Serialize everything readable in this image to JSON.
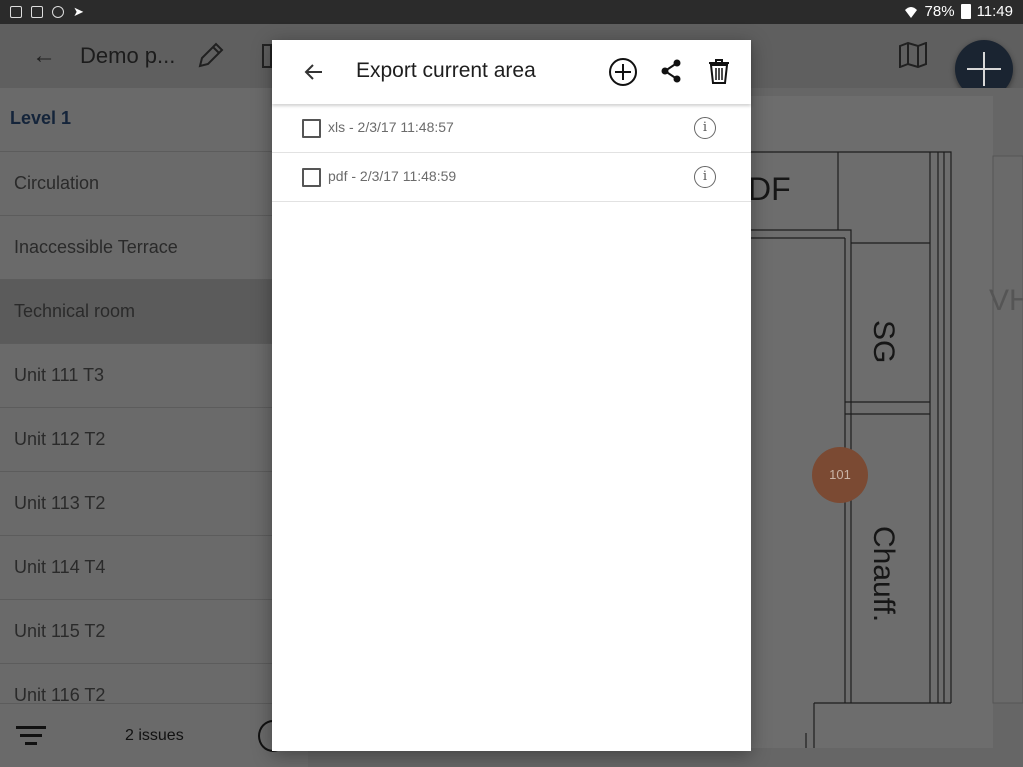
{
  "status_bar": {
    "battery": "78%",
    "time": "11:49"
  },
  "app_bar": {
    "title": "Demo p..."
  },
  "sidebar": {
    "level": "Level 1",
    "items": [
      "Circulation",
      "Inaccessible Terrace",
      "Technical room",
      "Unit 111 T3",
      "Unit 112 T2",
      "Unit 113 T2",
      "Unit 114 T4",
      "Unit 115 T2",
      "Unit 116 T2"
    ],
    "selected": "Technical room",
    "issues": "2 issues"
  },
  "plan": {
    "labels": {
      "df": "DF",
      "sg": "SG",
      "chauff": "Chauff.",
      "vh": "VH"
    },
    "marker": "101"
  },
  "dialog": {
    "title": "Export current area",
    "exports": [
      {
        "label": "xls - 2/3/17 11:48:57",
        "checked": false
      },
      {
        "label": "pdf - 2/3/17 11:48:59",
        "checked": false
      }
    ],
    "info_glyph": "i"
  },
  "icons": {
    "back": "back-arrow-icon",
    "edit": "pencil-icon",
    "map": "map-icon",
    "add": "add-circle-icon",
    "share": "share-icon",
    "delete": "trash-icon",
    "info": "info-icon",
    "filter": "filter-icon"
  },
  "colors": {
    "fab": "#1a2431",
    "marker": "#c56a42",
    "status_bar": "#2b2b2b"
  }
}
